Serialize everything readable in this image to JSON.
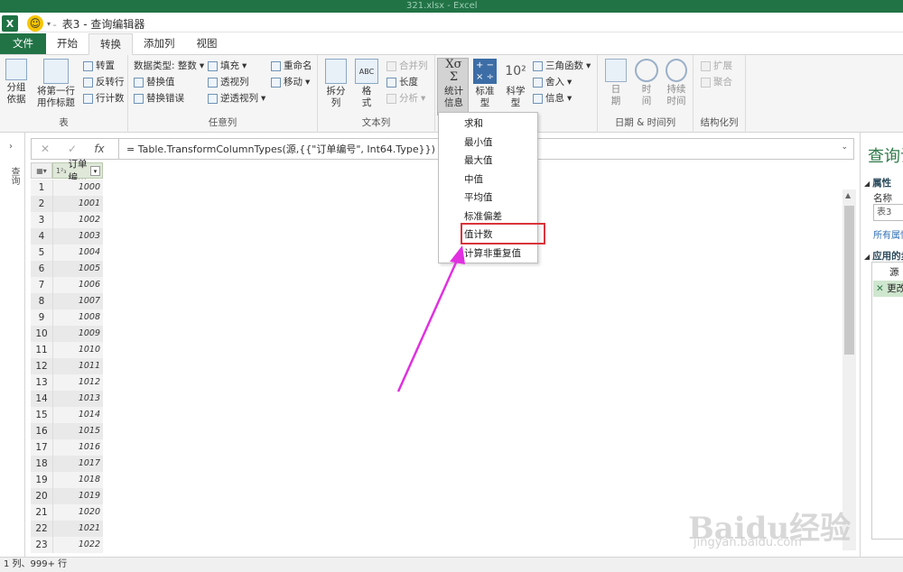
{
  "window": {
    "title": "表3 - 查询编辑器",
    "background_title": "321.xlsx - Excel",
    "app_icon": "X"
  },
  "tabs": [
    {
      "label": "文件"
    },
    {
      "label": "开始"
    },
    {
      "label": "转换"
    },
    {
      "label": "添加列"
    },
    {
      "label": "视图"
    }
  ],
  "ribbon": {
    "table_group": {
      "label": "表",
      "group_by": "分组\n依据",
      "use_first_row": "将第一行\n用作标题",
      "transpose": "转置",
      "reverse_rows": "反转行",
      "count_rows": "行计数"
    },
    "any_column_group": {
      "label": "任意列",
      "data_type": "数据类型: 整数",
      "replace_values": "替换值",
      "replace_errors": "替换错误",
      "fill": "填充",
      "pivot": "透视列",
      "unpivot": "逆透视列",
      "rename": "重命名",
      "move": "移动"
    },
    "text_column_group": {
      "label": "文本列",
      "split": "拆分\n列",
      "format": "格\n式",
      "merge": "合并列",
      "length": "长度",
      "analyze": "分析"
    },
    "number_column_group": {
      "statistics": "统计\n信息",
      "standard": "标准\n型",
      "scientific": "科学\n型",
      "trig": "三角函数",
      "rounding": "舍入",
      "info": "信息"
    },
    "datetime_group": {
      "label": "日期 & 时间列",
      "date": "日\n期",
      "time": "时\n间",
      "duration": "持续\n时间"
    },
    "structured_group": {
      "label": "结构化列",
      "expand": "扩展",
      "aggregate": "聚合"
    }
  },
  "formula": {
    "text": "= Table.TransformColumnTypes(源,{{\"订单编号\", Int64.Type}})",
    "fx": "fx"
  },
  "left_pane": {
    "label": "查询"
  },
  "grid": {
    "column_header": "订单编...",
    "rows": [
      {
        "n": "1",
        "v": "1000"
      },
      {
        "n": "2",
        "v": "1001"
      },
      {
        "n": "3",
        "v": "1002"
      },
      {
        "n": "4",
        "v": "1003"
      },
      {
        "n": "5",
        "v": "1004"
      },
      {
        "n": "6",
        "v": "1005"
      },
      {
        "n": "7",
        "v": "1006"
      },
      {
        "n": "8",
        "v": "1007"
      },
      {
        "n": "9",
        "v": "1008"
      },
      {
        "n": "10",
        "v": "1009"
      },
      {
        "n": "11",
        "v": "1010"
      },
      {
        "n": "12",
        "v": "1011"
      },
      {
        "n": "13",
        "v": "1012"
      },
      {
        "n": "14",
        "v": "1013"
      },
      {
        "n": "15",
        "v": "1014"
      },
      {
        "n": "16",
        "v": "1015"
      },
      {
        "n": "17",
        "v": "1016"
      },
      {
        "n": "18",
        "v": "1017"
      },
      {
        "n": "19",
        "v": "1018"
      },
      {
        "n": "20",
        "v": "1019"
      },
      {
        "n": "21",
        "v": "1020"
      },
      {
        "n": "22",
        "v": "1021"
      },
      {
        "n": "23",
        "v": "1022"
      }
    ]
  },
  "dropdown_menu": {
    "items": [
      "求和",
      "最小值",
      "最大值",
      "中值",
      "平均值",
      "标准偏差",
      "值计数",
      "计算非重复值"
    ],
    "highlighted": "值计数"
  },
  "right_pane": {
    "title": "查询设置",
    "properties": "属性",
    "name_label": "名称",
    "name_value": "表3",
    "all_properties": "所有属性",
    "applied_steps": "应用的步骤",
    "steps": [
      "源",
      "更改的类型"
    ]
  },
  "status": "1 列、999+ 行",
  "watermark": {
    "main": "Baidu经验",
    "sub": "jingyan.baidu.com"
  },
  "colors": {
    "excel_green": "#217346",
    "highlight_red": "#d9343a",
    "arrow_magenta": "#e030e0"
  }
}
